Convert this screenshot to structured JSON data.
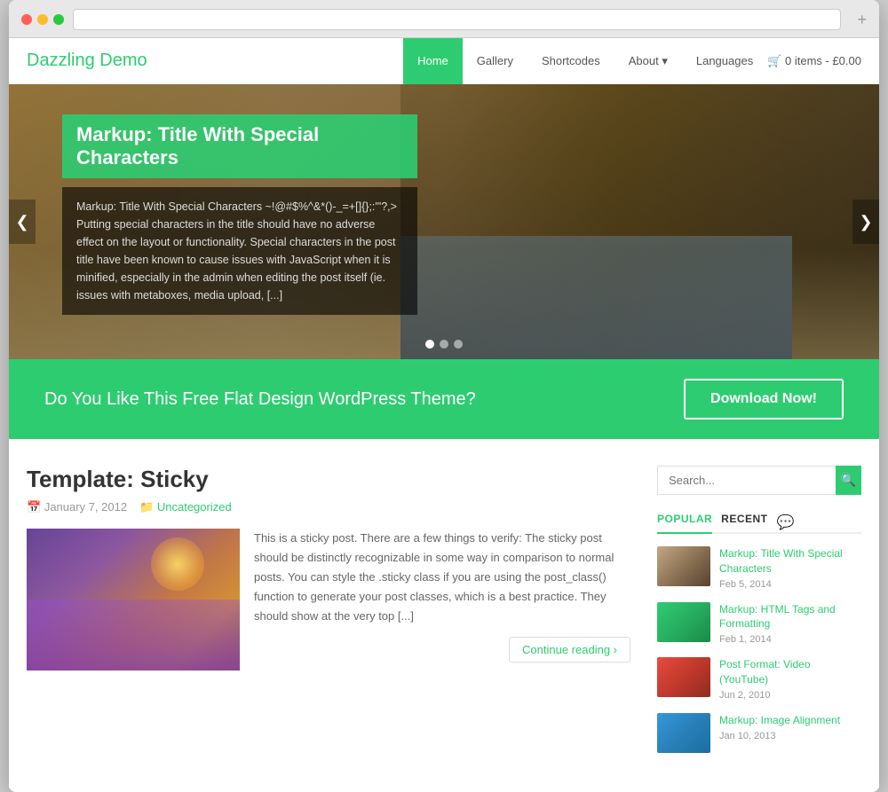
{
  "browser": {
    "addButton": "+"
  },
  "nav": {
    "logo": "Dazzling Demo",
    "items": [
      {
        "label": "Home",
        "active": true
      },
      {
        "label": "Gallery",
        "active": false
      },
      {
        "label": "Shortcodes",
        "active": false
      },
      {
        "label": "About ▾",
        "active": false
      },
      {
        "label": "Languages",
        "active": false
      }
    ],
    "cart": "🛒 0 items - £0.00"
  },
  "hero": {
    "title": "Markup: Title With Special Characters",
    "description": "Markup: Title With Special Characters ~!@#$%^&*()-_=+[]{};:'\"?,> Putting special characters in the title should have no adverse effect on the layout or functionality. Special characters in the post title have been known to cause issues with JavaScript when it is minified, especially in the admin when editing the post itself (ie. issues with metaboxes, media upload, [...]",
    "arrowLeft": "❮",
    "arrowRight": "❯",
    "dots": [
      true,
      false,
      false
    ]
  },
  "cta": {
    "text": "Do You Like This Free Flat Design WordPress Theme?",
    "buttonLabel": "Download Now!"
  },
  "article": {
    "title": "Template: Sticky",
    "meta": {
      "date": "January 7, 2012",
      "category": "Uncategorized"
    },
    "body": "This is a sticky post. There are a few things to verify: The sticky post should be distinctly recognizable in some way in comparison to normal posts. You can style the .sticky class if you are using the post_class() function to generate your post classes, which is a best practice. They should show at the very top [...]",
    "continueLabel": "Continue reading ›"
  },
  "sidebar": {
    "searchPlaceholder": "Search...",
    "tabs": [
      {
        "label": "POPULAR",
        "active": true
      },
      {
        "label": "RECENT",
        "active": false
      }
    ],
    "tabIconLabel": "💬",
    "posts": [
      {
        "title": "Markup: Title With Special Characters",
        "date": "Feb 5, 2014",
        "imgClass": "spi-1"
      },
      {
        "title": "Markup: HTML Tags and Formatting",
        "date": "Feb 1, 2014",
        "imgClass": "spi-2"
      },
      {
        "title": "Post Format: Video (YouTube)",
        "date": "Jun 2, 2010",
        "imgClass": "spi-3"
      },
      {
        "title": "Markup: Image Alignment",
        "date": "Jan 10, 2013",
        "imgClass": "spi-4"
      }
    ]
  }
}
